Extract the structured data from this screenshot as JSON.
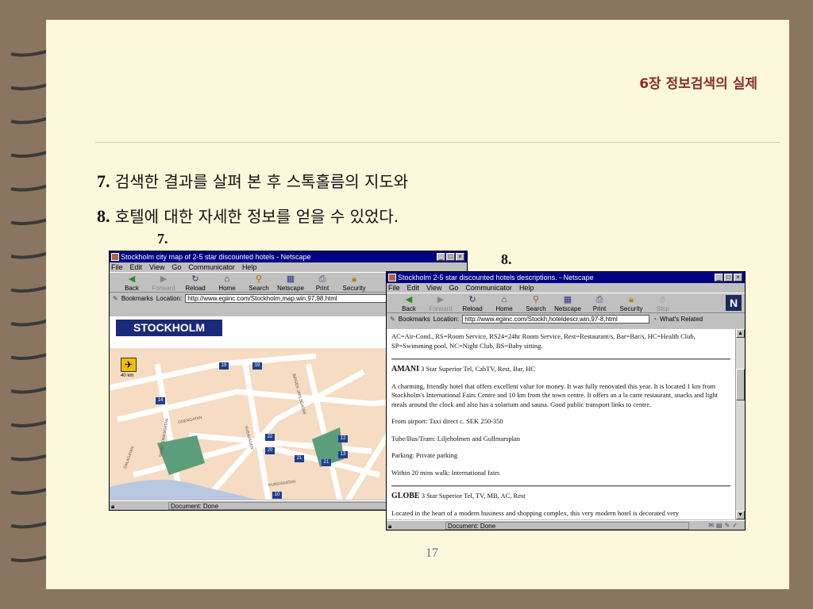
{
  "slide": {
    "chapter": "6장 정보검색의 실제",
    "line1_num": "7.",
    "line1_text": "검색한 결과를 살펴 본 후 스톡홀름의 지도와",
    "line2_num": "8.",
    "line2_text": "호텔에 대한 자세한 정보를 얻을 수 있었다.",
    "label7": "7.",
    "label8": "8.",
    "page_number": "17"
  },
  "menu": [
    "File",
    "Edit",
    "View",
    "Go",
    "Communicator",
    "Help"
  ],
  "toolbar": [
    "Back",
    "Forward",
    "Reload",
    "Home",
    "Search",
    "Netscape",
    "Print",
    "Security",
    "Stop"
  ],
  "window1": {
    "title": "Stockholm city map of 2-5 star discounted hotels - Netscape",
    "bookmarks": "Bookmarks",
    "location_label": "Location:",
    "url": "http://www.egiinc.com/Stockholm,map,win,97,98.html",
    "status": "Document: Done",
    "map": {
      "banner": "STOCKHOLM",
      "scale": "40 km",
      "markers": [
        "19",
        "19",
        "14",
        "22",
        "20",
        "21",
        "21",
        "12",
        "13",
        "10"
      ],
      "streets": [
        "ODENGATAN",
        "DALAGATAN",
        "SVEAVÄGEN",
        "KUNGSGATAN",
        "BIRGER JARLSGATAN",
        "SANKT ERIKSGATAN"
      ]
    }
  },
  "window2": {
    "title": "Stockholm 2-5 star discounted hotels descriptions. - Netscape",
    "bookmarks": "Bookmarks",
    "location_label": "Location:",
    "url": "http://www.egiinc.com/Stockh,hoteldescr,win,97-8,html",
    "related": "What's Related",
    "status": "Document: Done",
    "legend": "AC=Air-Cond., RS=Room Service, RS24=24hr Room Service, Rest=Restaurant/s, Bar=Bar/s, HC=Health Club, SP=Swimming pool, NC=Night Club, BS=Baby sitting.",
    "amani_name": "AMANI",
    "amani_info": "3 Star Superior Tel, CabTV, Rest, Bar, HC",
    "amani_desc": "A charming, friendly hotel that offers excellent value for money. It was fully renovated this year. It is located 1 km from Stockholm's International Fairs Centre and 10 km from the town centre. It offers an a la carte restaurant, snacks and light meals around the clock and also has a solarium and sauna. Good public transport links to centre.",
    "airport": "From airport: Taxi direct c. SEK 250-350",
    "tube": "Tube/Bus/Tram: Liljeholmen and Gullmarsplan",
    "parking": "Parking: Private parking",
    "walk": "Within 20 mins walk: International fairs",
    "globe_name": "GLOBE",
    "globe_info": "3 Star Superior Tel, TV, MB, AC, Rest",
    "globe_desc": "Located in the heart of a modern business and shopping complex, this very modern hotel is decorated very"
  }
}
